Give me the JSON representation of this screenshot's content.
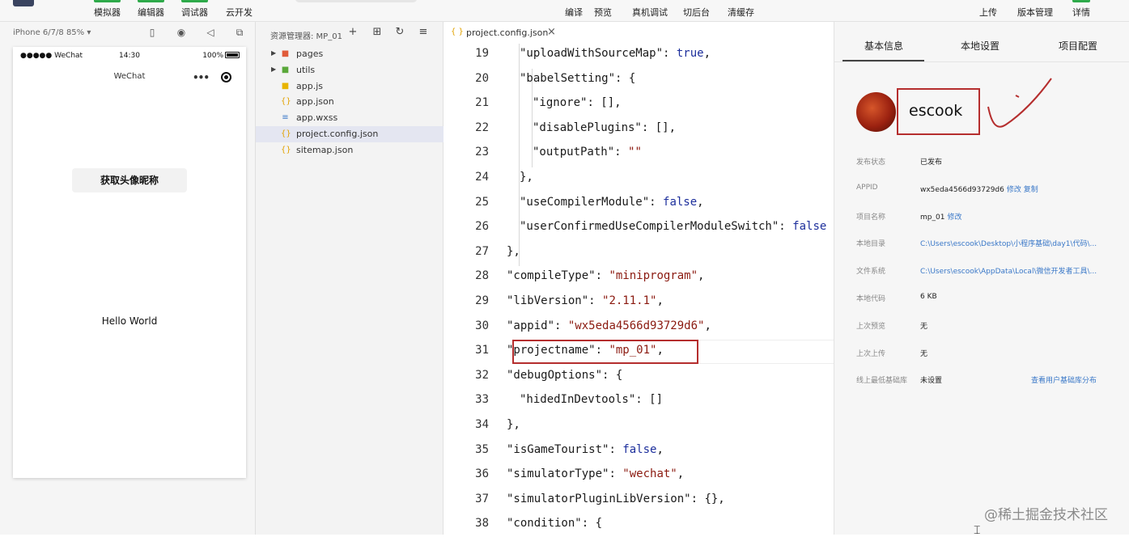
{
  "toolbar": {
    "left": [
      "模拟器",
      "编辑器",
      "调试器",
      "云开发"
    ],
    "center": [
      "编译",
      "预览",
      "真机调试",
      "切后台",
      "清缓存"
    ],
    "right": [
      "上传",
      "版本管理",
      "详情"
    ],
    "accent": "#2eaa4a"
  },
  "simulator": {
    "device": "iPhone 6/7/8 85% ▾",
    "status": {
      "signal": "●●●●● WeChat",
      "time": "14:30",
      "battery": "100%"
    },
    "nav_title": "WeChat",
    "button_label": "获取头像昵称",
    "text": "Hello World"
  },
  "explorer": {
    "title": "资源管理器: MP_01",
    "items": [
      {
        "name": "pages",
        "type": "folder",
        "icon": "folder-red-icon"
      },
      {
        "name": "utils",
        "type": "folder",
        "icon": "folder-green-icon"
      },
      {
        "name": "app.js",
        "type": "file",
        "icon": "js-file-icon"
      },
      {
        "name": "app.json",
        "type": "file",
        "icon": "json-file-icon"
      },
      {
        "name": "app.wxss",
        "type": "file",
        "icon": "wxss-file-icon"
      },
      {
        "name": "project.config.json",
        "type": "file",
        "icon": "json-file-icon",
        "selected": true
      },
      {
        "name": "sitemap.json",
        "type": "file",
        "icon": "json-file-icon"
      }
    ]
  },
  "editor": {
    "tab": {
      "brace": "{ }",
      "name": "project.config.json",
      "close": "×"
    },
    "lines": [
      {
        "n": "19",
        "key": "\"uploadWithSourceMap\"",
        "sep": ": ",
        "val": "true",
        "vt": "b",
        "end": ",",
        "indent": 2
      },
      {
        "n": "20",
        "key": "\"babelSetting\"",
        "sep": ": ",
        "val": "{",
        "vt": "p",
        "end": "",
        "indent": 2
      },
      {
        "n": "21",
        "key": "\"ignore\"",
        "sep": ": ",
        "val": "[]",
        "vt": "p",
        "end": ",",
        "indent": 3
      },
      {
        "n": "22",
        "key": "\"disablePlugins\"",
        "sep": ": ",
        "val": "[]",
        "vt": "p",
        "end": ",",
        "indent": 3
      },
      {
        "n": "23",
        "key": "\"outputPath\"",
        "sep": ": ",
        "val": "\"\"",
        "vt": "s",
        "end": "",
        "indent": 3
      },
      {
        "n": "24",
        "key": "",
        "sep": "",
        "val": "},",
        "vt": "p",
        "end": "",
        "indent": 2
      },
      {
        "n": "25",
        "key": "\"useCompilerModule\"",
        "sep": ": ",
        "val": "false",
        "vt": "b",
        "end": ",",
        "indent": 2
      },
      {
        "n": "26",
        "key": "\"userConfirmedUseCompilerModuleSwitch\"",
        "sep": ": ",
        "val": "false",
        "vt": "b",
        "end": "",
        "indent": 2
      },
      {
        "n": "27",
        "key": "",
        "sep": "",
        "val": "},",
        "vt": "p",
        "end": "",
        "indent": 1
      },
      {
        "n": "28",
        "key": "\"compileType\"",
        "sep": ": ",
        "val": "\"miniprogram\"",
        "vt": "s",
        "end": ",",
        "indent": 1
      },
      {
        "n": "29",
        "key": "\"libVersion\"",
        "sep": ": ",
        "val": "\"2.11.1\"",
        "vt": "s",
        "end": ",",
        "indent": 1
      },
      {
        "n": "30",
        "key": "\"appid\"",
        "sep": ": ",
        "val": "\"wx5eda4566d93729d6\"",
        "vt": "s",
        "end": ",",
        "indent": 1
      },
      {
        "n": "31",
        "key": "\"projectname\"",
        "sep": ": ",
        "val": "\"mp_01\"",
        "vt": "s",
        "end": ",",
        "indent": 1,
        "boxed": true
      },
      {
        "n": "32",
        "key": "\"debugOptions\"",
        "sep": ": ",
        "val": "{",
        "vt": "p",
        "end": "",
        "indent": 1
      },
      {
        "n": "33",
        "key": "\"hidedInDevtools\"",
        "sep": ": ",
        "val": "[]",
        "vt": "p",
        "end": "",
        "indent": 2
      },
      {
        "n": "34",
        "key": "",
        "sep": "",
        "val": "},",
        "vt": "p",
        "end": "",
        "indent": 1
      },
      {
        "n": "35",
        "key": "\"isGameTourist\"",
        "sep": ": ",
        "val": "false",
        "vt": "b",
        "end": ",",
        "indent": 1
      },
      {
        "n": "36",
        "key": "\"simulatorType\"",
        "sep": ": ",
        "val": "\"wechat\"",
        "vt": "s",
        "end": ",",
        "indent": 1
      },
      {
        "n": "37",
        "key": "\"simulatorPluginLibVersion\"",
        "sep": ": ",
        "val": "{}",
        "vt": "p",
        "end": ",",
        "indent": 1
      },
      {
        "n": "38",
        "key": "\"condition\"",
        "sep": ": ",
        "val": "{",
        "vt": "p",
        "end": "",
        "indent": 1
      }
    ]
  },
  "details": {
    "tabs": [
      "基本信息",
      "本地设置",
      "项目配置"
    ],
    "nickname": "escook",
    "rows": [
      {
        "k": "发布状态",
        "v": "已发布"
      },
      {
        "k": "APPID",
        "v": "wx5eda4566d93729d6",
        "links": "修改 复制"
      },
      {
        "k": "项目名称",
        "v": "mp_01",
        "links": "修改"
      },
      {
        "k": "本地目录",
        "v": "C:\\Users\\escook\\Desktop\\小程序基础\\day1\\代码\\...",
        "link_value": true
      },
      {
        "k": "文件系统",
        "v": "C:\\Users\\escook\\AppData\\Local\\微信开发者工具\\...",
        "link_value": true
      },
      {
        "k": "本地代码",
        "v": "6 KB"
      },
      {
        "k": "上次预览",
        "v": "无"
      },
      {
        "k": "上次上传",
        "v": "无"
      },
      {
        "k": "线上最低基础库",
        "v": "未设置",
        "right_link": "查看用户基础库分布"
      }
    ]
  },
  "watermark": "@稀土掘金技术社区",
  "colors": {
    "annotation_red": "#b52e2e",
    "link": "#3a78c8",
    "string": "#8b1a10",
    "keyword": "#1d2f9c"
  }
}
